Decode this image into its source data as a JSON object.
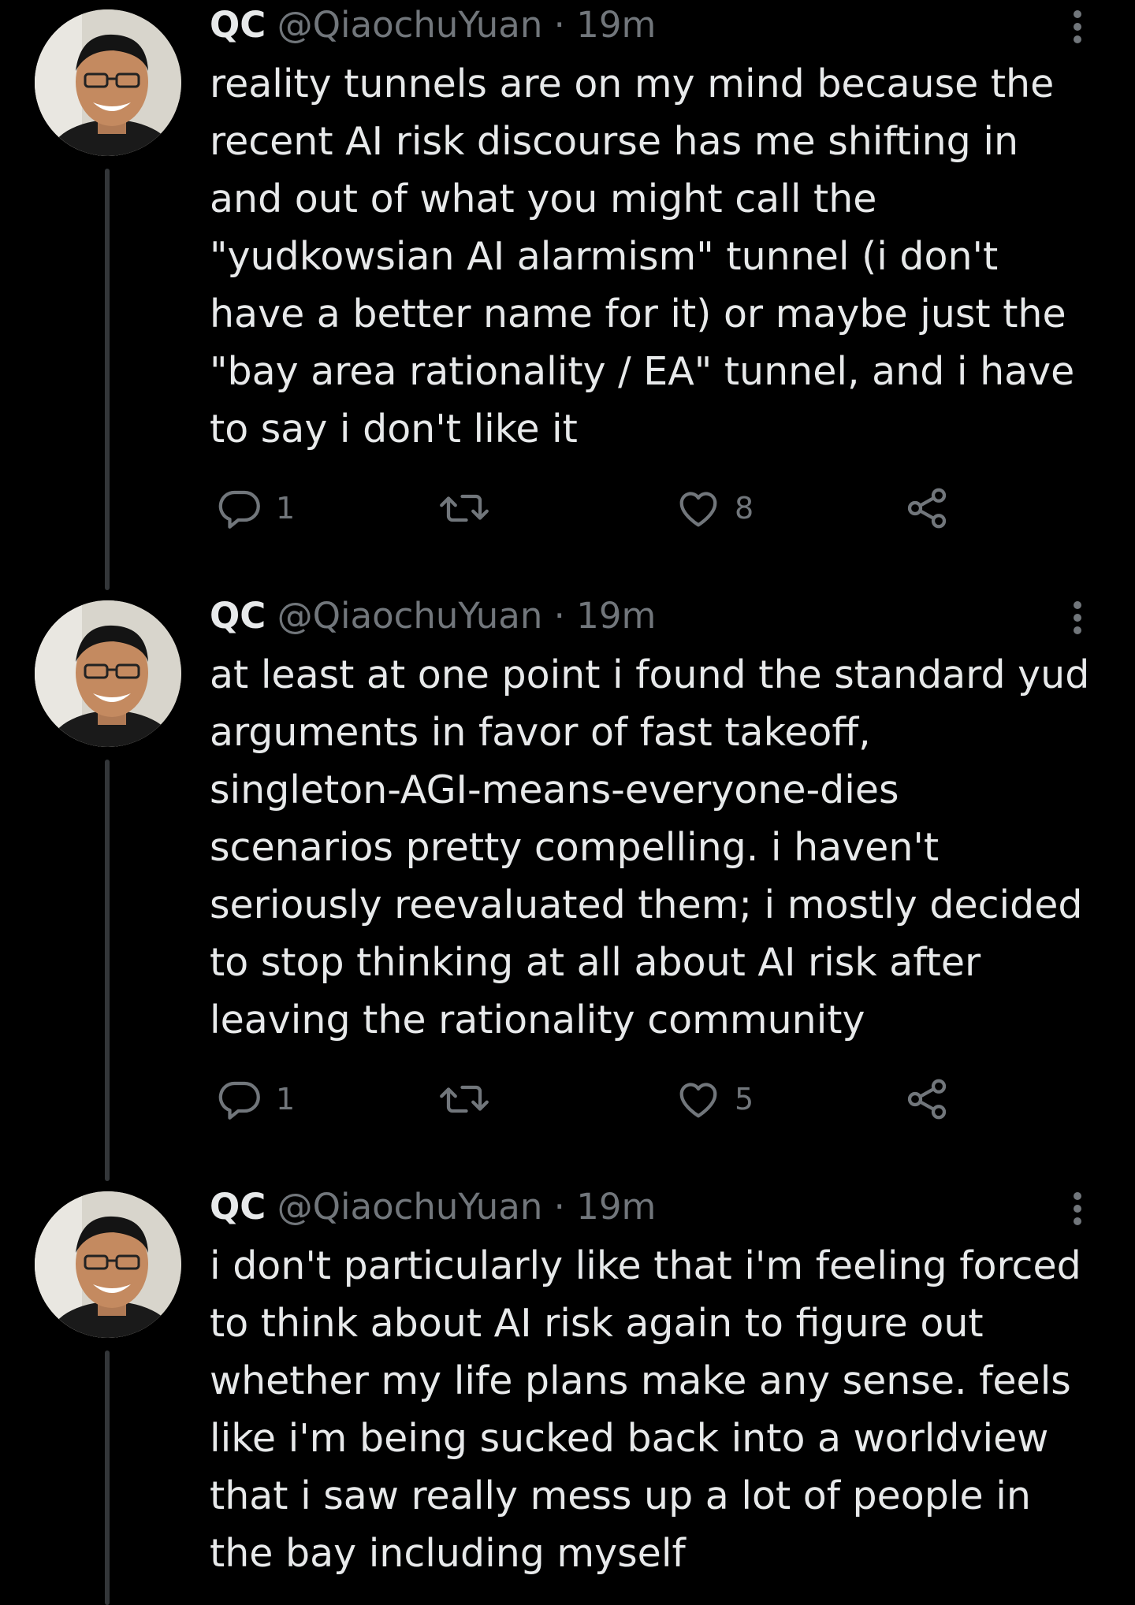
{
  "theme": {
    "background": "#000000",
    "text": "#e7e9ea",
    "muted": "#71767b",
    "thread_line": "#333639"
  },
  "tweets": [
    {
      "display_name": "QC",
      "handle": "@QiaochuYuan",
      "separator": "·",
      "time": "19m",
      "lines": [
        "reality tunnels are on my mind because the",
        "recent AI risk discourse has me shifting in",
        "and out of what you might call the",
        "\"yudkowsian AI alarmism\" tunnel (i don't",
        "have a better name for it) or maybe just the",
        "\"bay area rationality / EA\" tunnel, and i have",
        "to say i don't like it"
      ],
      "replies": "1",
      "retweets": "",
      "likes": "8"
    },
    {
      "display_name": "QC",
      "handle": "@QiaochuYuan",
      "separator": "·",
      "time": "19m",
      "lines": [
        "at least at one point i found the standard yud",
        "arguments in favor of fast takeoff,",
        "singleton-AGI-means-everyone-dies",
        "scenarios pretty compelling. i haven't",
        "seriously reevaluated them; i mostly decided",
        "to stop thinking at all about AI risk after",
        "leaving the rationality community"
      ],
      "replies": "1",
      "retweets": "",
      "likes": "5"
    },
    {
      "display_name": "QC",
      "handle": "@QiaochuYuan",
      "separator": "·",
      "time": "19m",
      "lines": [
        "i don't particularly like that i'm feeling forced",
        "to think about AI risk again to figure out",
        "whether my life plans make any sense. feels",
        "like i'm being sucked back into a worldview",
        "that i saw really mess up a lot of people in",
        "the bay including myself"
      ]
    }
  ],
  "icons": {
    "avatar": "avatar-photo",
    "more": "more-vertical-icon",
    "reply": "reply-bubble-icon",
    "retweet": "retweet-arrows-icon",
    "like": "heart-icon",
    "share": "share-nodes-icon"
  }
}
